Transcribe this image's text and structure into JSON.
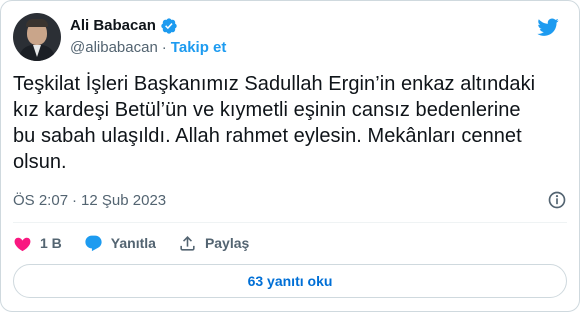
{
  "author": {
    "name": "Ali Babacan",
    "handle": "@alibabacan",
    "follow_label": "Takip et",
    "separator": "·"
  },
  "tweet": {
    "text": "Teşkilat İşleri Başkanımız Sadullah Ergin’in enkaz altındaki\nkız kardeşi Betül’ün ve kıymetli eşinin cansız bedenlerine\nbu sabah ulaşıldı. Allah rahmet eylesin. Mekânları cennet\nolsun.",
    "time": "ÖS 2:07",
    "separator": "·",
    "date": "12 Şub 2023"
  },
  "actions": {
    "like_count": "1 B",
    "reply_label": "Yanıtla",
    "share_label": "Paylaş"
  },
  "footer": {
    "replies_button": "63 yanıtı oku"
  },
  "colors": {
    "brand": "#1d9bf0",
    "like": "#f91880",
    "text": "#0f1419",
    "muted": "#536471",
    "border": "#cfd9de"
  },
  "icons": [
    "verified-badge-icon",
    "twitter-bird-icon",
    "info-icon",
    "heart-icon",
    "reply-icon",
    "share-icon"
  ]
}
